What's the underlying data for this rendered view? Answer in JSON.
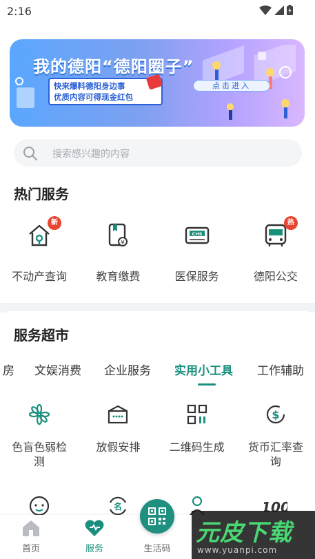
{
  "status": {
    "time": "2:16"
  },
  "banner": {
    "title": "我的德阳“德阳圈子”",
    "line1": "快来爆料德阳身边事",
    "line2": "优质内容可得现金红包",
    "cta": "点击进入"
  },
  "search": {
    "placeholder": "搜索感兴趣的内容"
  },
  "hot": {
    "title": "热门服务",
    "items": [
      {
        "label": "不动产查询",
        "icon": "house-icon",
        "badge": "新"
      },
      {
        "label": "教育缴费",
        "icon": "education-fee-icon",
        "badge": ""
      },
      {
        "label": "医保服务",
        "icon": "medical-insurance-card-icon",
        "badge": ""
      },
      {
        "label": "德阳公交",
        "icon": "bus-icon",
        "badge": "热"
      }
    ]
  },
  "market": {
    "title": "服务超市",
    "tabs": [
      "房",
      "文娱消费",
      "企业服务",
      "实用小工具",
      "工作辅助"
    ],
    "active_tab": "实用小工具",
    "tools_row1": [
      {
        "label": "色盲色弱检测",
        "icon": "color-test-icon"
      },
      {
        "label": "放假安排",
        "icon": "calendar-icon"
      },
      {
        "label": "二维码生成",
        "icon": "qr-generate-icon"
      },
      {
        "label": "货币汇率查询",
        "icon": "currency-icon"
      }
    ],
    "tools_row2": [
      {
        "icon": "baby-face-icon"
      },
      {
        "icon": "name-refresh-icon"
      },
      {
        "icon": "person-icon"
      },
      {
        "icon": "number-100-icon"
      }
    ]
  },
  "nav": {
    "items": [
      {
        "label": "首页",
        "icon": "home-icon"
      },
      {
        "label": "服务",
        "icon": "service-heart-icon"
      },
      {
        "label": "生活码",
        "icon": "qr-code-icon"
      }
    ],
    "active": "服务"
  },
  "watermark": {
    "logo": "元皮下载",
    "url": "www.yuanpi.com"
  },
  "colors": {
    "accent": "#1a8f7e",
    "badge": "#e8452e",
    "background": "#ffffff",
    "band": "#f2f3f5"
  }
}
